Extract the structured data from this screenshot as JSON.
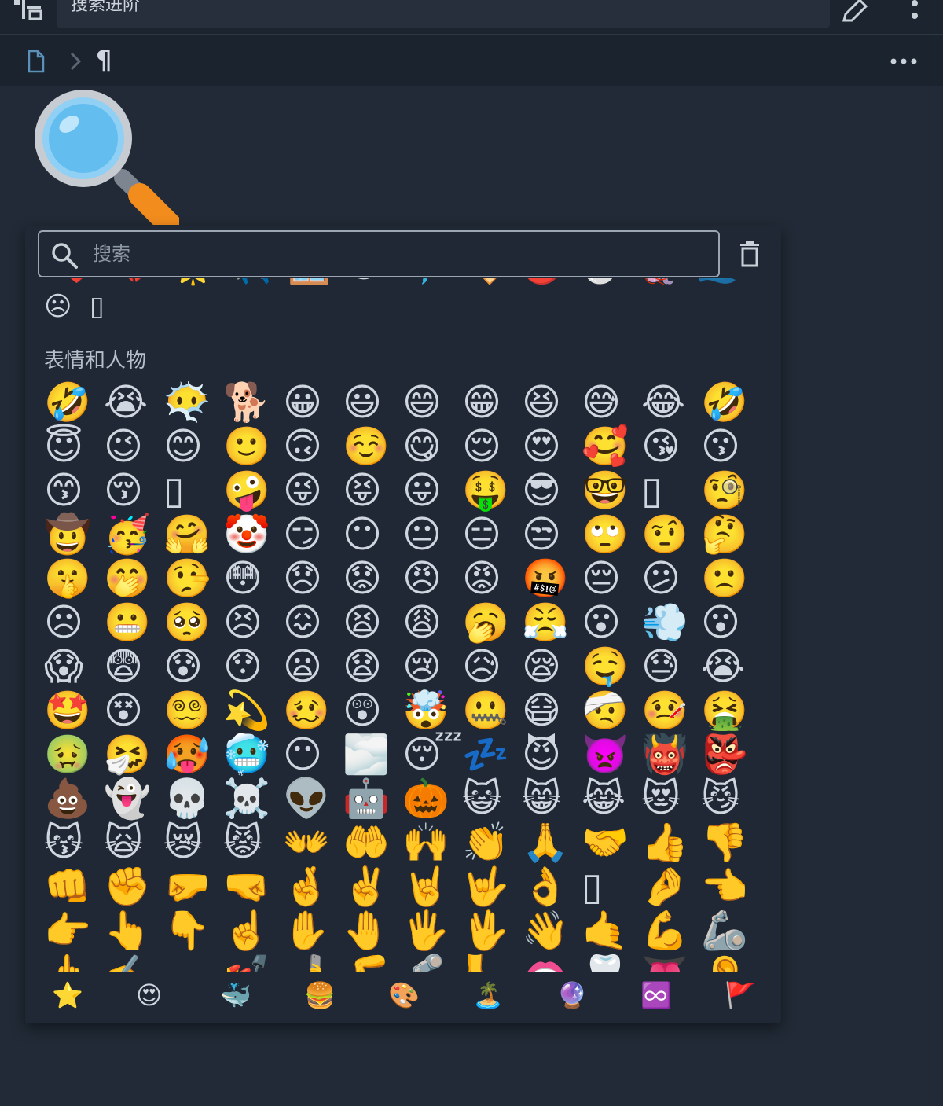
{
  "topbar": {
    "title": "搜索进阶",
    "icons": [
      "tree-icon",
      "edit-icon",
      "more-vertical-icon"
    ]
  },
  "breadcrumb": {
    "icons": [
      "document-icon",
      "chevron-right-icon",
      "paragraph-icon",
      "more-horizontal-icon"
    ],
    "paragraph_mark": "¶"
  },
  "block_emoji": "🔍",
  "emoji_picker": {
    "search_placeholder": "搜索",
    "search_value": "",
    "recent_partial": [
      "❤️",
      "💔",
      "🌟",
      "✈️",
      "🪟",
      "😀",
      "🐬",
      "🏷️",
      "🔴",
      "🐣",
      "🪼",
      "🌊"
    ],
    "recent": [
      "☹",
      "▯"
    ],
    "category_title": "表情和人物",
    "emojis": [
      "🤣",
      "😭",
      "😶‍🌫️",
      "🐕",
      "😀",
      "😃",
      "😄",
      "😁",
      "😆",
      "😅",
      "😂",
      "🤣",
      "😇",
      "😉",
      "😊",
      "🙂",
      "🙃",
      "☺️",
      "😋",
      "😌",
      "😍",
      "🥰",
      "😘",
      "😗",
      "😙",
      "😚",
      "▯",
      "🤪",
      "😜",
      "😝",
      "😛",
      "🤑",
      "😎",
      "🤓",
      "▯",
      "🧐",
      "🤠",
      "🥳",
      "🤗",
      "🤡",
      "😏",
      "😶",
      "😐",
      "😑",
      "😒",
      "🙄",
      "🤨",
      "🤔",
      "🤫",
      "🤭",
      "🤥",
      "😳",
      "😞",
      "😟",
      "😠",
      "😡",
      "🤬",
      "😔",
      "😕",
      "🙁",
      "☹",
      "😬",
      "🥺",
      "😣",
      "😖",
      "😫",
      "😩",
      "🥱",
      "😤",
      "😮",
      "💨",
      "😮",
      "😱",
      "😨",
      "😰",
      "😯",
      "😦",
      "😧",
      "😢",
      "😥",
      "😪",
      "🤤",
      "😓",
      "😭",
      "🤩",
      "😵",
      "😵‍💫",
      "💫",
      "🥴",
      "😲",
      "🤯",
      "🤐",
      "😷",
      "🤕",
      "🤒",
      "🤮",
      "🤢",
      "🤧",
      "🥵",
      "🥶",
      "😶",
      "🌫️",
      "😴",
      "💤",
      "😈",
      "👿",
      "👹",
      "👺",
      "💩",
      "👻",
      "💀",
      "☠️",
      "👽",
      "🤖",
      "🎃",
      "😺",
      "😸",
      "😹",
      "😻",
      "😼",
      "😽",
      "🙀",
      "😿",
      "😾",
      "👐",
      "🤲",
      "🙌",
      "👏",
      "🙏",
      "🤝",
      "👍",
      "👎",
      "👊",
      "✊",
      "🤛",
      "🤜",
      "🤞",
      "✌️",
      "🤘",
      "🤟",
      "👌",
      "▯",
      "🤌",
      "👈",
      "👉",
      "👆",
      "👇",
      "☝️",
      "✋",
      "🤚",
      "🖐️",
      "🖖",
      "👋",
      "🤙",
      "💪",
      "🦾",
      "🖕",
      "✍️",
      "",
      "💅",
      "🤳",
      "🦵",
      "🦿",
      "🦶",
      "👄",
      "🦷",
      "👅",
      "👂",
      "🦻"
    ],
    "category_nav": [
      "⭐",
      "😍",
      "🐳",
      "🍔",
      "🎨",
      "🏝️",
      "🔮",
      "♾️",
      "🚩"
    ]
  }
}
